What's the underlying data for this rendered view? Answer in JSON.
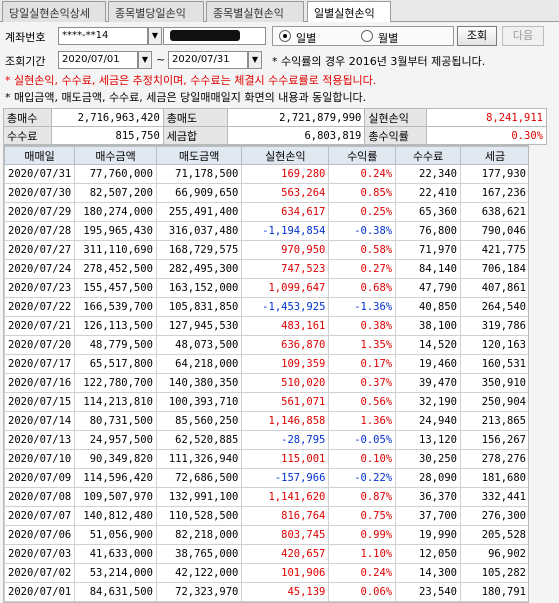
{
  "tabs": [
    {
      "label": "당일실현손익상세",
      "active": false
    },
    {
      "label": "종목별당일손익",
      "active": false
    },
    {
      "label": "종목별실현손익",
      "active": false
    },
    {
      "label": "일별실현손익",
      "active": true
    }
  ],
  "account": {
    "label": "계좌번호",
    "value": "****-**14"
  },
  "period": {
    "label": "조회기간",
    "from": "2020/07/01",
    "separator": "~",
    "to": "2020/07/31"
  },
  "radio": {
    "daily": "일별",
    "monthly": "월별",
    "selected": "daily"
  },
  "buttons": {
    "search": "조회",
    "next": "다음"
  },
  "notes": {
    "rate_note": "* 수익률의 경우 2016년 3월부터 제공됩니다.",
    "warning": "* 실현손익, 수수료, 세금은 추정치이며, 수수료는 체결시 수수료률로 적용됩니다.",
    "info": "* 매입금액, 매도금액, 수수료, 세금은 당일매매일지 화면의 내용과 동일합니다."
  },
  "summary": {
    "total_buy_label": "총매수",
    "total_buy": "2,716,963,420",
    "total_sell_label": "총매도",
    "total_sell": "2,721,879,990",
    "realized_label": "실현손익",
    "realized": "8,241,911",
    "fee_label": "수수료",
    "fee": "815,750",
    "tax_label": "세금합",
    "tax": "6,803,819",
    "total_rate_label": "총수익률",
    "total_rate": "0.30%"
  },
  "grid": {
    "columns": [
      "매매일",
      "매수금액",
      "매도금액",
      "실현손익",
      "수익률",
      "수수료",
      "세금"
    ],
    "rows": [
      [
        "2020/07/31",
        "77,760,000",
        "71,178,500",
        "169,280",
        "0.24%",
        "22,340",
        "177,930"
      ],
      [
        "2020/07/30",
        "82,507,200",
        "66,909,650",
        "563,264",
        "0.85%",
        "22,410",
        "167,236"
      ],
      [
        "2020/07/29",
        "180,274,000",
        "255,491,400",
        "634,617",
        "0.25%",
        "65,360",
        "638,621"
      ],
      [
        "2020/07/28",
        "195,965,430",
        "316,037,480",
        "-1,194,854",
        "-0.38%",
        "76,800",
        "790,046"
      ],
      [
        "2020/07/27",
        "311,110,690",
        "168,729,575",
        "970,950",
        "0.58%",
        "71,970",
        "421,775"
      ],
      [
        "2020/07/24",
        "278,452,500",
        "282,495,300",
        "747,523",
        "0.27%",
        "84,140",
        "706,184"
      ],
      [
        "2020/07/23",
        "155,457,500",
        "163,152,000",
        "1,099,647",
        "0.68%",
        "47,790",
        "407,861"
      ],
      [
        "2020/07/22",
        "166,539,700",
        "105,831,850",
        "-1,453,925",
        "-1.36%",
        "40,850",
        "264,540"
      ],
      [
        "2020/07/21",
        "126,113,500",
        "127,945,530",
        "483,161",
        "0.38%",
        "38,100",
        "319,786"
      ],
      [
        "2020/07/20",
        "48,779,500",
        "48,073,500",
        "636,870",
        "1.35%",
        "14,520",
        "120,163"
      ],
      [
        "2020/07/17",
        "65,517,800",
        "64,218,000",
        "109,359",
        "0.17%",
        "19,460",
        "160,531"
      ],
      [
        "2020/07/16",
        "122,780,700",
        "140,380,350",
        "510,020",
        "0.37%",
        "39,470",
        "350,910"
      ],
      [
        "2020/07/15",
        "114,213,810",
        "100,393,710",
        "561,071",
        "0.56%",
        "32,190",
        "250,904"
      ],
      [
        "2020/07/14",
        "80,731,500",
        "85,560,250",
        "1,146,858",
        "1.36%",
        "24,940",
        "213,865"
      ],
      [
        "2020/07/13",
        "24,957,500",
        "62,520,885",
        "-28,795",
        "-0.05%",
        "13,120",
        "156,267"
      ],
      [
        "2020/07/10",
        "90,349,820",
        "111,326,940",
        "115,001",
        "0.10%",
        "30,250",
        "278,276"
      ],
      [
        "2020/07/09",
        "114,596,420",
        "72,686,500",
        "-157,966",
        "-0.22%",
        "28,090",
        "181,680"
      ],
      [
        "2020/07/08",
        "109,507,970",
        "132,991,100",
        "1,141,620",
        "0.87%",
        "36,370",
        "332,441"
      ],
      [
        "2020/07/07",
        "140,812,480",
        "110,528,500",
        "816,764",
        "0.75%",
        "37,700",
        "276,300"
      ],
      [
        "2020/07/06",
        "51,056,900",
        "82,218,000",
        "803,745",
        "0.99%",
        "19,990",
        "205,528"
      ],
      [
        "2020/07/03",
        "41,633,000",
        "38,765,000",
        "420,657",
        "1.10%",
        "12,050",
        "96,902"
      ],
      [
        "2020/07/02",
        "53,214,000",
        "42,122,000",
        "101,906",
        "0.24%",
        "14,300",
        "105,282"
      ],
      [
        "2020/07/01",
        "84,631,500",
        "72,323,970",
        "45,139",
        "0.06%",
        "23,540",
        "180,791"
      ]
    ]
  },
  "colors": {
    "positive": "#e00000",
    "negative": "#0030d0",
    "header_bg": "#e1e8f0"
  }
}
